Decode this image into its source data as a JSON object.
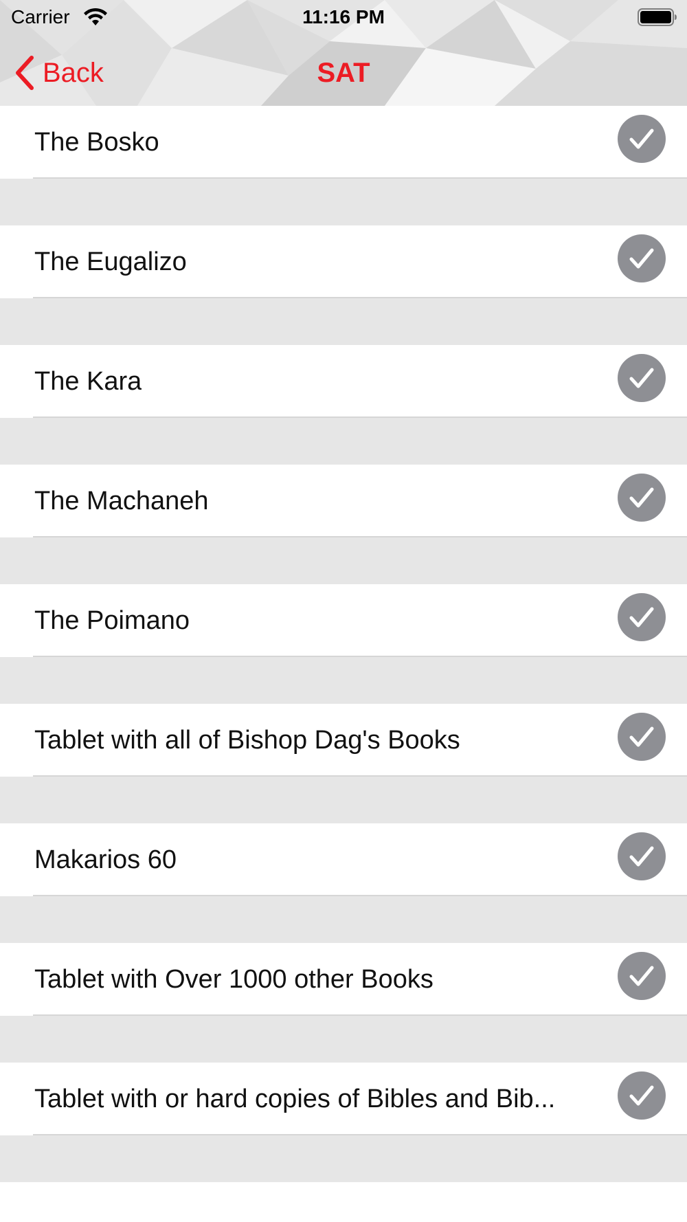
{
  "status_bar": {
    "carrier": "Carrier",
    "time": "11:16 PM"
  },
  "nav": {
    "back_label": "Back",
    "title": "SAT"
  },
  "colors": {
    "accent": "#ec1c24",
    "check_bg": "#8e8f94",
    "separator_bg": "#e6e6e6"
  },
  "list": {
    "items": [
      {
        "label": "The Bosko",
        "checked": true
      },
      {
        "label": "The Eugalizo",
        "checked": true
      },
      {
        "label": "The Kara",
        "checked": true
      },
      {
        "label": "The Machaneh",
        "checked": true
      },
      {
        "label": "The Poimano",
        "checked": true
      },
      {
        "label": "Tablet with all of Bishop Dag's Books",
        "checked": true
      },
      {
        "label": "Makarios 60",
        "checked": true
      },
      {
        "label": "Tablet with Over 1000 other Books",
        "checked": true
      },
      {
        "label": "Tablet with or hard copies of Bibles and Bib...",
        "checked": true
      }
    ]
  },
  "icons": {
    "back": "chevron-left-icon",
    "check": "checkmark-icon",
    "wifi": "wifi-icon",
    "battery": "battery-icon"
  }
}
